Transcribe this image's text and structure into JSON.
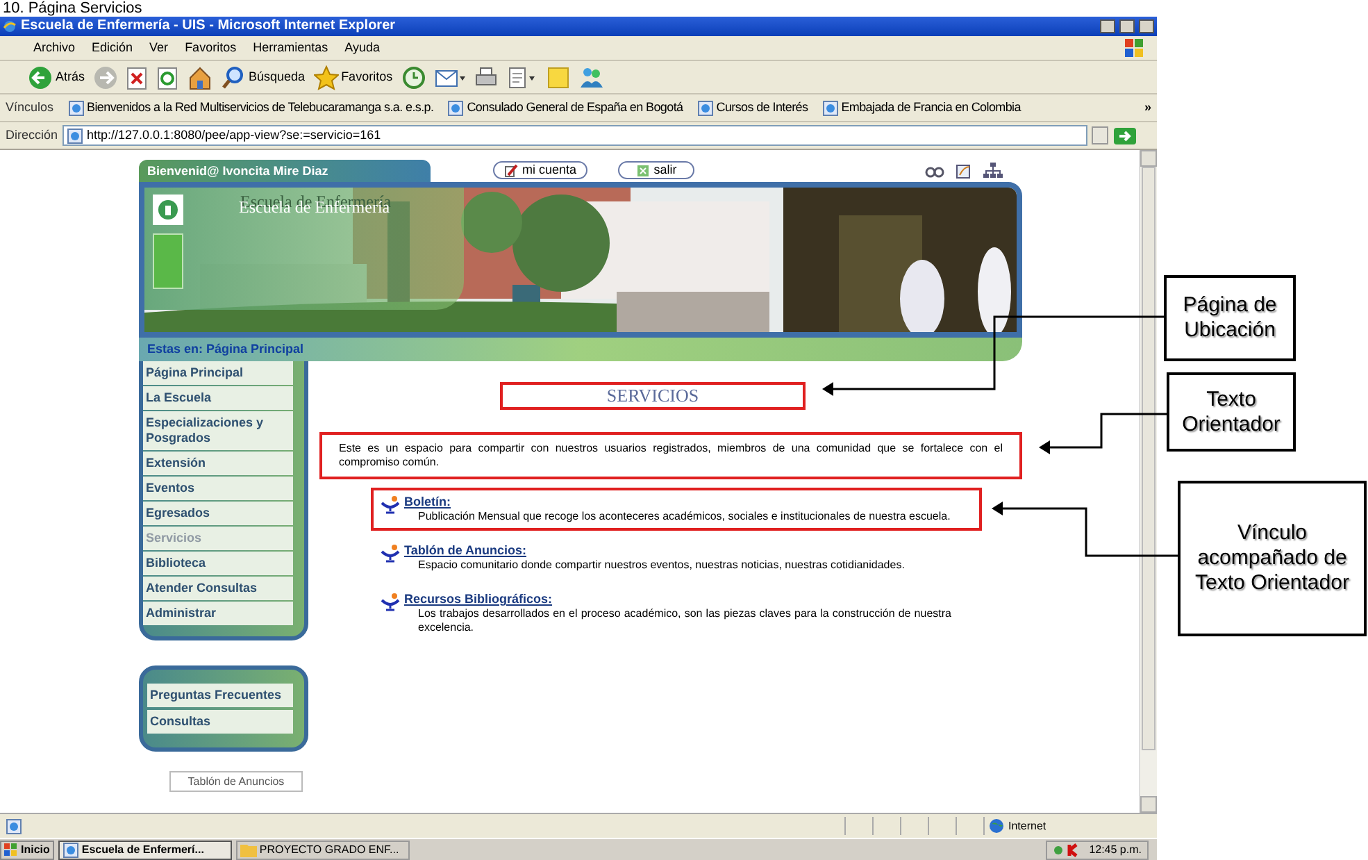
{
  "caption": "10. Página Servicios",
  "window": {
    "title": "Escuela de Enfermería - UIS - Microsoft Internet Explorer",
    "menu": [
      "Archivo",
      "Edición",
      "Ver",
      "Favoritos",
      "Herramientas",
      "Ayuda"
    ],
    "toolbar": [
      {
        "kind": "back",
        "label": "Atrás"
      },
      {
        "kind": "forward"
      },
      {
        "kind": "stop"
      },
      {
        "kind": "refresh"
      },
      {
        "kind": "home"
      },
      {
        "kind": "search",
        "label": "Búsqueda"
      },
      {
        "kind": "favorites",
        "label": "Favoritos"
      },
      {
        "kind": "history"
      },
      {
        "kind": "mail"
      },
      {
        "kind": "print"
      },
      {
        "kind": "edit"
      },
      {
        "kind": "folder"
      },
      {
        "kind": "messenger"
      }
    ],
    "links_bar": {
      "label": "Vínculos",
      "items": [
        "Bienvenidos a la Red Multiservicios de Telebucaramanga s.a. e.s.p.",
        "Consulado General de España en Bogotá",
        "Cursos de Interés",
        "Embajada de Francia en Colombia"
      ],
      "more": "»"
    },
    "address": {
      "label": "Dirección",
      "value": "http://127.0.0.1:8080/pee/app-view?se:=servicio=161"
    }
  },
  "page": {
    "welcome": "Bienvenid@ Ivoncita Mire Diaz",
    "account_buttons": [
      {
        "kind": "account",
        "label": "mi cuenta"
      },
      {
        "kind": "exit",
        "label": "salir"
      }
    ],
    "school_name": "Escuela de Enfermería",
    "breadcrumb": "Estas en: Página Principal",
    "nav": [
      {
        "label": "Página Principal",
        "selected": false
      },
      {
        "label": "La Escuela",
        "selected": false
      },
      {
        "label": "Especializaciones y Posgrados",
        "selected": false
      },
      {
        "label": "Extensión",
        "selected": false
      },
      {
        "label": "Eventos",
        "selected": false
      },
      {
        "label": "Egresados",
        "selected": false
      },
      {
        "label": "Servicios",
        "selected": true
      },
      {
        "label": "Biblioteca",
        "selected": false
      },
      {
        "label": "Atender Consultas",
        "selected": false
      },
      {
        "label": "Administrar",
        "selected": false
      }
    ],
    "secondary_nav": [
      "Preguntas Frecuentes",
      "Consultas"
    ],
    "bottom_button": "Tablón de Anuncios",
    "title": "SERVICIOS",
    "intro": "Este es un espacio para compartir con nuestros usuarios registrados, miembros de una comunidad que se fortalece con el compromiso común.",
    "links": [
      {
        "title": "Boletín:",
        "description": "Publicación Mensual que recoge los aconteceres académicos, sociales e institucionales de nuestra escuela.",
        "highlighted": true
      },
      {
        "title": "Tablón de Anuncios:",
        "description": "Espacio comunitario donde compartir nuestros eventos, nuestras noticias, nuestras cotidianidades.",
        "highlighted": false
      },
      {
        "title": "Recursos Bibliográficos:",
        "description": "Los trabajos desarrollados en el proceso académico, son las piezas claves para la construcción de nuestra excelencia.",
        "highlighted": false
      }
    ]
  },
  "status_bar": {
    "zone": "Internet"
  },
  "taskbar": {
    "start": "Inicio",
    "tasks": [
      {
        "label": "Escuela de Enfermerí...",
        "selected": true
      },
      {
        "label": "PROYECTO GRADO ENF...",
        "selected": false
      }
    ],
    "clock": "12:45 p.m."
  },
  "annotations": [
    "Página de Ubicación",
    "Texto Orientador",
    "Vínculo acompañado de Texto Orientador"
  ]
}
